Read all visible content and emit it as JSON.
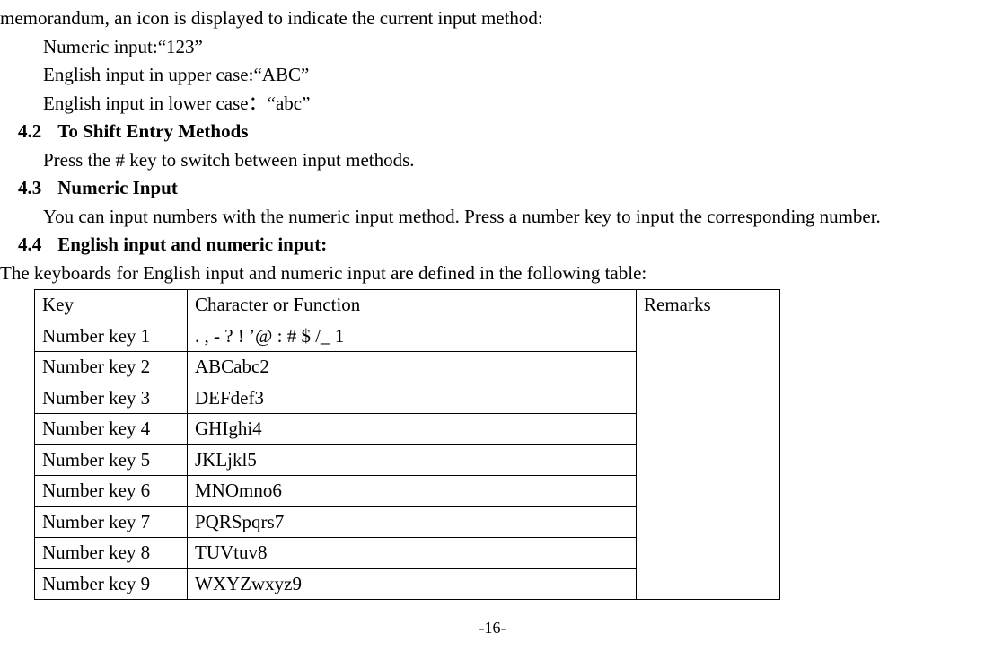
{
  "intro_line": "memorandum, an icon is displayed to indicate the current input method:",
  "methods": {
    "numeric": "Numeric input:“123”",
    "upper": "English input in upper case:“ABC”",
    "lower": "English input in lower case：“abc”"
  },
  "sec42": {
    "num": "4.2",
    "title": "To Shift Entry Methods",
    "body": "Press the # key to switch between input methods."
  },
  "sec43": {
    "num": "4.3",
    "title": "Numeric Input",
    "body": "You can input numbers with the numeric input method. Press a number key to input the corresponding number."
  },
  "sec44": {
    "num": "4.4",
    "title": "English input and numeric input:",
    "body": "The keyboards for English input and numeric input are defined in the following table:"
  },
  "table": {
    "headers": {
      "key": "Key",
      "char": "Character or Function",
      "remarks": "Remarks"
    },
    "rows": [
      {
        "key": "Number key 1",
        "char": ". , - ? ! ’@ : # $ /_ 1"
      },
      {
        "key": "Number key 2",
        "char": "ABCabc2"
      },
      {
        "key": "Number key 3",
        "char": "DEFdef3"
      },
      {
        "key": "Number key 4",
        "char": "GHIghi4"
      },
      {
        "key": "Number key 5",
        "char": "JKLjkl5"
      },
      {
        "key": "Number key 6",
        "char": "MNOmno6"
      },
      {
        "key": "Number key 7",
        "char": "PQRSpqrs7"
      },
      {
        "key": "Number key 8",
        "char": "TUVtuv8"
      },
      {
        "key": "Number key 9",
        "char": "WXYZwxyz9"
      }
    ]
  },
  "page_number": "-16-"
}
